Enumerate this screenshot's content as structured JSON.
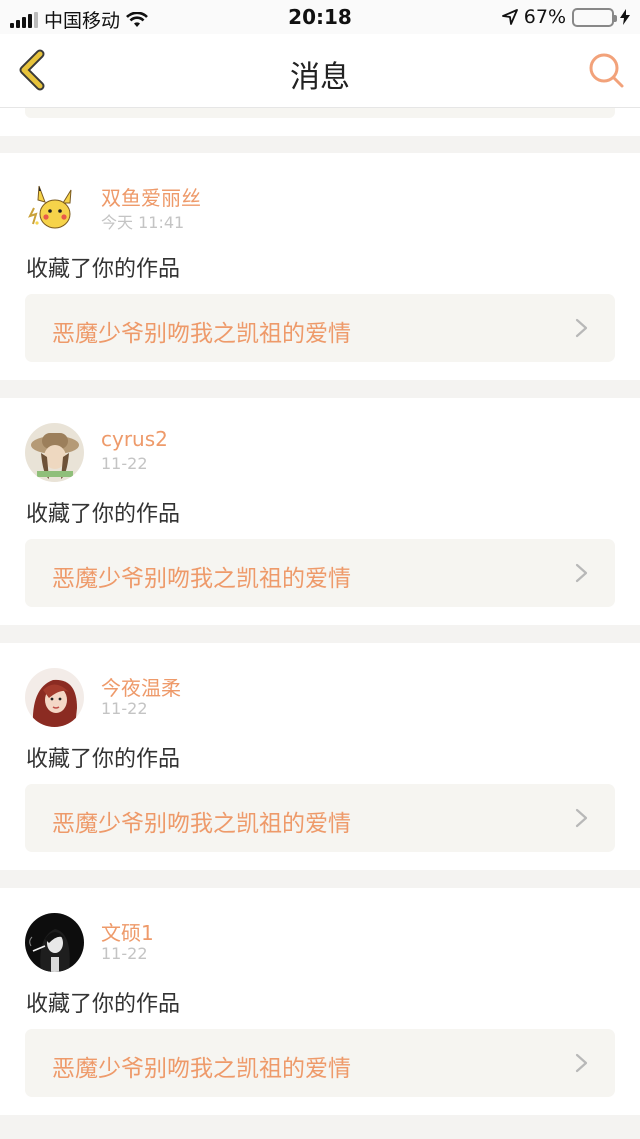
{
  "status_bar": {
    "carrier": "中国移动",
    "time": "20:18",
    "battery_percent": "67%",
    "battery_level": 0.67,
    "icons": [
      "signal-bars-icon",
      "wifi-icon",
      "location-arrow-icon",
      "battery-icon",
      "charging-bolt-icon"
    ]
  },
  "nav": {
    "title": "消息",
    "back_icon": "chevron-left-icon",
    "search_icon": "search-icon"
  },
  "colors": {
    "accent": "#ee9a6a",
    "back_icon": "#e7c33c",
    "search_icon": "#f2a27a",
    "card_bg": "#ffffff",
    "work_box_bg": "#f6f5f1",
    "page_bg": "#f4f3f1"
  },
  "messages": [
    {
      "username": "双鱼爱丽丝",
      "time": "今天 11:41",
      "action": "收藏了你的作品",
      "work_title": "恶魔少爷别吻我之凯祖的爱情",
      "avatar": "pikachu-avatar"
    },
    {
      "username": "cyrus2",
      "time": "11-22",
      "action": "收藏了你的作品",
      "work_title": "恶魔少爷别吻我之凯祖的爱情",
      "avatar": "girl-hat-avatar"
    },
    {
      "username": "今夜温柔",
      "time": "11-22",
      "action": "收藏了你的作品",
      "work_title": "恶魔少爷别吻我之凯祖的爱情",
      "avatar": "red-hair-avatar"
    },
    {
      "username": "文硕1",
      "time": "11-22",
      "action": "收藏了你的作品",
      "work_title": "恶魔少爷别吻我之凯祖的爱情",
      "avatar": "dark-silhouette-avatar"
    }
  ]
}
